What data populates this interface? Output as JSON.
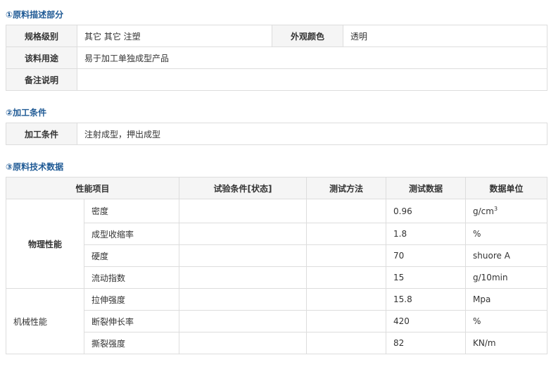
{
  "section1": {
    "title": "①原料描述部分",
    "spec_label": "规格级别",
    "spec_value": "其它 其它 注塑",
    "appearance_label": "外观颜色",
    "appearance_value": "透明",
    "usage_label": "该料用途",
    "usage_value": "易于加工单独成型产品",
    "note_label": "备注说明",
    "note_value": ""
  },
  "section2": {
    "title": "②加工条件",
    "label": "加工条件",
    "value": "注射成型，押出成型"
  },
  "section3": {
    "title": "③原料技术数据",
    "headers": [
      "性能项目",
      "试验条件[状态]",
      "测试方法",
      "测试数据",
      "数据单位"
    ],
    "groups": [
      {
        "name": "物理性能",
        "rows": [
          {
            "item": "密度",
            "condition": "",
            "method": "",
            "value": "0.96",
            "unit": "g/cm",
            "unit_sup": "3"
          },
          {
            "item": "成型收缩率",
            "condition": "",
            "method": "",
            "value": "1.8",
            "unit": "%"
          },
          {
            "item": "硬度",
            "condition": "",
            "method": "",
            "value": "70",
            "unit": "shuore A"
          },
          {
            "item": "流动指数",
            "condition": "",
            "method": "",
            "value": "15",
            "unit": "g/10min"
          }
        ]
      },
      {
        "name": "机械性能",
        "rows": [
          {
            "item": "拉伸强度",
            "condition": "",
            "method": "",
            "value": "15.8",
            "unit": "Mpa"
          },
          {
            "item": "断裂伸长率",
            "condition": "",
            "method": "",
            "value": "420",
            "unit": "%"
          },
          {
            "item": "撕裂强度",
            "condition": "",
            "method": "",
            "value": "82",
            "unit": "KN/m"
          }
        ]
      }
    ]
  }
}
